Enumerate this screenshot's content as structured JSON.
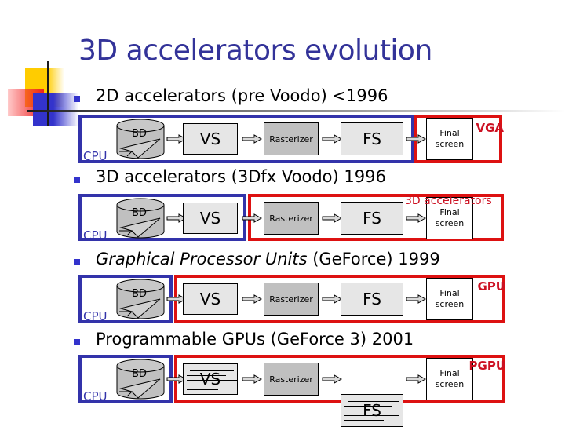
{
  "title": "3D accelerators evolution",
  "colors": {
    "title": "#333399",
    "cpu_frame": "#3333aa",
    "gpu_frame": "#dd1111",
    "bullet": "#3333cc"
  },
  "sections": [
    {
      "bullet": "2D accelerators (pre Voodo) <1996",
      "cpu_label": "CPU",
      "hw_label": "VGA",
      "stages": {
        "db": "BD",
        "vs": "VS",
        "rast": "Rasterizer",
        "fs": "FS",
        "final_1": "Final",
        "final_2": "screen"
      }
    },
    {
      "bullet": "3D accelerators (3Dfx Voodo) 1996",
      "cpu_label": "CPU",
      "hw_label": "3D accelerators",
      "stages": {
        "db": "BD",
        "vs": "VS",
        "rast": "Rasterizer",
        "fs": "FS",
        "final_1": "Final",
        "final_2": "screen"
      }
    },
    {
      "bullet_italic": "Graphical Processor Units",
      "bullet_rest": " (GeForce) 1999",
      "cpu_label": "CPU",
      "hw_label": "GPU",
      "stages": {
        "db": "BD",
        "vs": "VS",
        "rast": "Rasterizer",
        "fs": "FS",
        "final_1": "Final",
        "final_2": "screen"
      }
    },
    {
      "bullet": "Programmable GPUs (GeForce 3) 2001",
      "cpu_label": "CPU",
      "hw_label": "PGPU",
      "stages": {
        "db": "BD",
        "vs": "VS",
        "rast": "Rasterizer",
        "fs": "FS",
        "final_1": "Final",
        "final_2": "screen"
      }
    }
  ]
}
